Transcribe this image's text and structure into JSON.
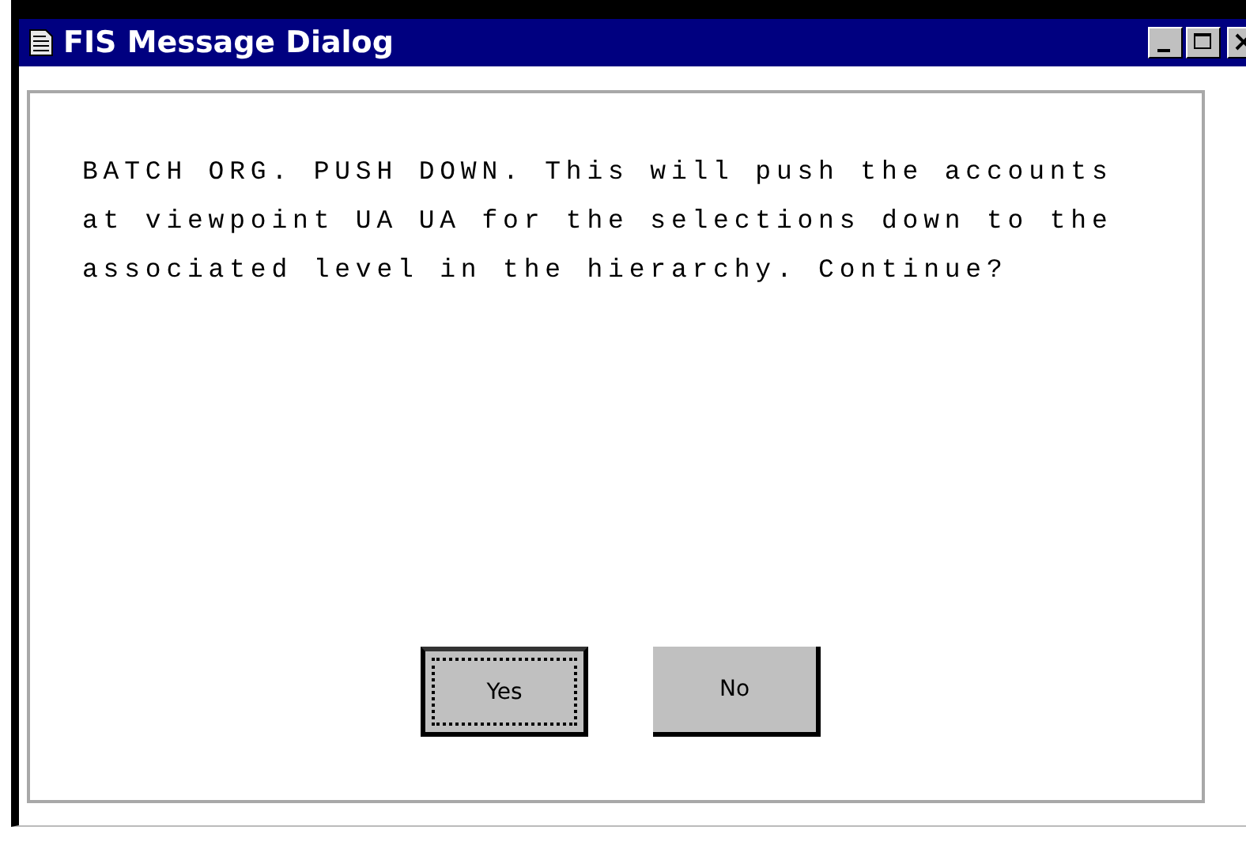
{
  "window": {
    "title": "FIS Message Dialog"
  },
  "message": "BATCH ORG. PUSH DOWN. This will push the accounts at viewpoint UA UA for the selections down to the associated level in the hierarchy. Continue?",
  "buttons": [
    {
      "label": "Yes",
      "default": true
    },
    {
      "label": "No",
      "default": false
    }
  ]
}
